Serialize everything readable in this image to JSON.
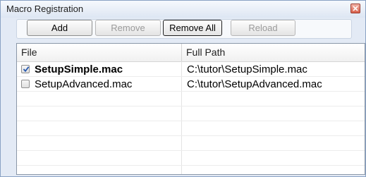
{
  "window": {
    "title": "Macro Registration"
  },
  "toolbar": {
    "add_label": "Add",
    "remove_label": "Remove",
    "remove_all_label": "Remove All",
    "reload_label": "Reload"
  },
  "table": {
    "columns": [
      "File",
      "Full Path"
    ],
    "rows": [
      {
        "checked": true,
        "file": "SetupSimple.mac",
        "path": "C:\\tutor\\SetupSimple.mac"
      },
      {
        "checked": false,
        "file": "SetupAdvanced.mac",
        "path": "C:\\tutor\\SetupAdvanced.mac"
      }
    ]
  },
  "icons": {
    "close": "close-icon",
    "check": "checkmark-icon"
  },
  "colors": {
    "close_button": "#d9614c",
    "checkmark": "#2a5bb0"
  }
}
